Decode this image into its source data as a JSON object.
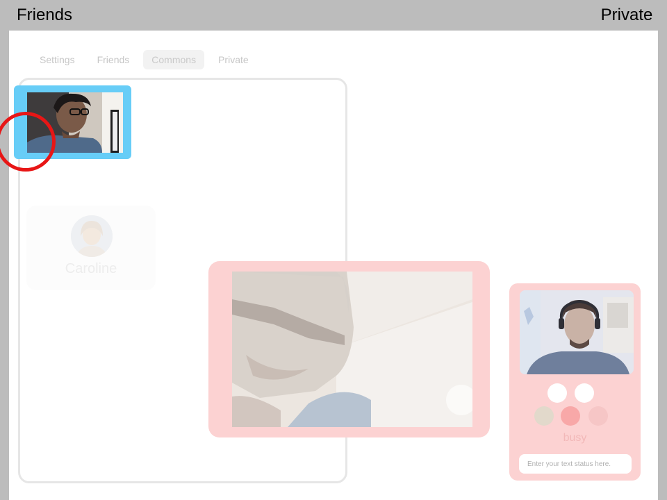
{
  "corners": {
    "left_label": "Friends",
    "right_label": "Private"
  },
  "tabs": [
    {
      "label": "Settings",
      "active": false
    },
    {
      "label": "Friends",
      "active": false
    },
    {
      "label": "Commons",
      "active": true
    },
    {
      "label": "Private",
      "active": false
    }
  ],
  "room": {
    "friend_card": {
      "name": "Caroline"
    }
  },
  "self_tile": {
    "border_color": "#67cdf7"
  },
  "status_card": {
    "status_label": "busy",
    "input_placeholder": "Enter your text status here.",
    "dots": [
      {
        "color": "#ffffff",
        "name": "white-dot-left"
      },
      {
        "color": "#ffffff",
        "name": "white-dot-right"
      },
      {
        "color": "#e2d9cb",
        "name": "available-dot"
      },
      {
        "color": "#f8a8a8",
        "name": "busy-dot"
      },
      {
        "color": "#f6c6c6",
        "name": "away-dot"
      }
    ]
  },
  "colors": {
    "accent_call": "#fcd2d2",
    "cursor_ring": "#e81616",
    "side_bars": "#bcbcbc"
  }
}
